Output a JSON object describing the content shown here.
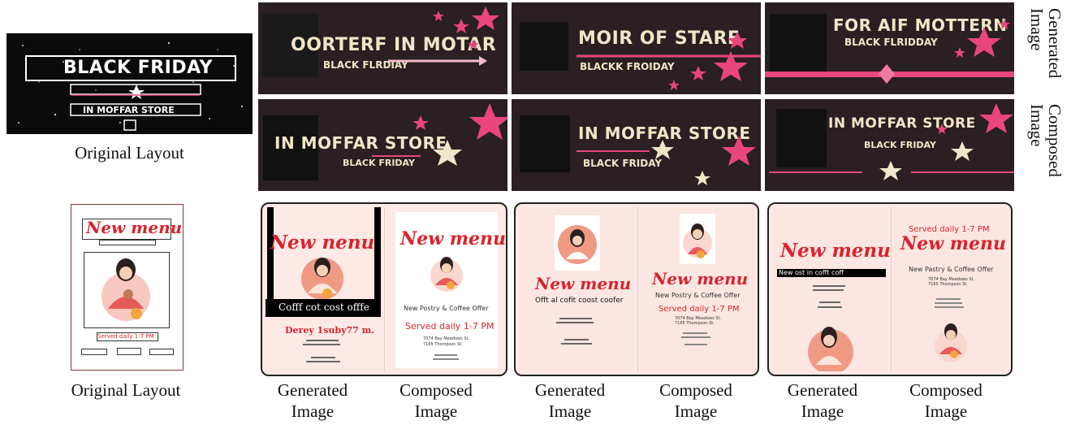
{
  "side_labels": {
    "generated": "Generated Image",
    "composed": "Composed Image"
  },
  "top": {
    "original": {
      "title": "BLACK FRIDAY",
      "subtitle": "IN MOFFAR STORE",
      "caption": "Original Layout"
    },
    "generated": [
      {
        "title": "OORTERF IN MOTAR",
        "subtitle": "BLACK FLRDIAY"
      },
      {
        "title": "MOIR OF STARE",
        "subtitle": "BLACKK FROIDAY"
      },
      {
        "title": "FOR AIF MOTTERN",
        "subtitle": "BLACK FLRIDDAY"
      }
    ],
    "composed": [
      {
        "title": "IN MOFFAR STORE",
        "subtitle": "BLACK FRIDAY"
      },
      {
        "title": "IN MOFFAR STORE",
        "subtitle": "BLACK FRIDAY"
      },
      {
        "title": "IN MOFFAR STORE",
        "subtitle": "BLACK FRIDAY"
      }
    ]
  },
  "bottom": {
    "original": {
      "title": "New menu",
      "served": "Served daily 1-7 PM",
      "caption": "Original Layout"
    },
    "panels": [
      {
        "gen": {
          "title": "New nenu",
          "band": "Cofff cot cost offfe",
          "red": "Derey 1suby77 m."
        },
        "comp": {
          "title": "New menu",
          "sub": "New Postry & Coffee Offer",
          "red": "Served daily 1-7 PM",
          "addr1": "7074 Bay Meadows St.",
          "addr2": "7165 Thompson St."
        }
      },
      {
        "gen": {
          "title": "New menu",
          "sub": "Offt al cofit coost coofer"
        },
        "comp": {
          "title": "New menu",
          "sub": "New Postry & Coffee Offer",
          "red": "Served daily 1-7 PM",
          "addr1": "7074 Bay Meadows St.",
          "addr2": "7165 Thompson St."
        }
      },
      {
        "gen": {
          "title": "New menu",
          "band": "New ost in cofft coff"
        },
        "comp": {
          "title": "New menu",
          "red": "Served daily 1-7 PM",
          "sub": "New Pastry & Coffee Offer",
          "addr1": "7074 Bay Meadows St.",
          "addr2": "7165 Thompson St."
        }
      }
    ],
    "captions": [
      "Generated Image",
      "Composed Image",
      "Generated Image",
      "Composed Image",
      "Generated Image",
      "Composed Image"
    ]
  },
  "colors": {
    "banner_bg": "#2a1f22",
    "pink": "#e8467c",
    "cream": "#f0e6c8",
    "menu_red": "#d8242d",
    "poster_bg": "#fbe6e2"
  }
}
